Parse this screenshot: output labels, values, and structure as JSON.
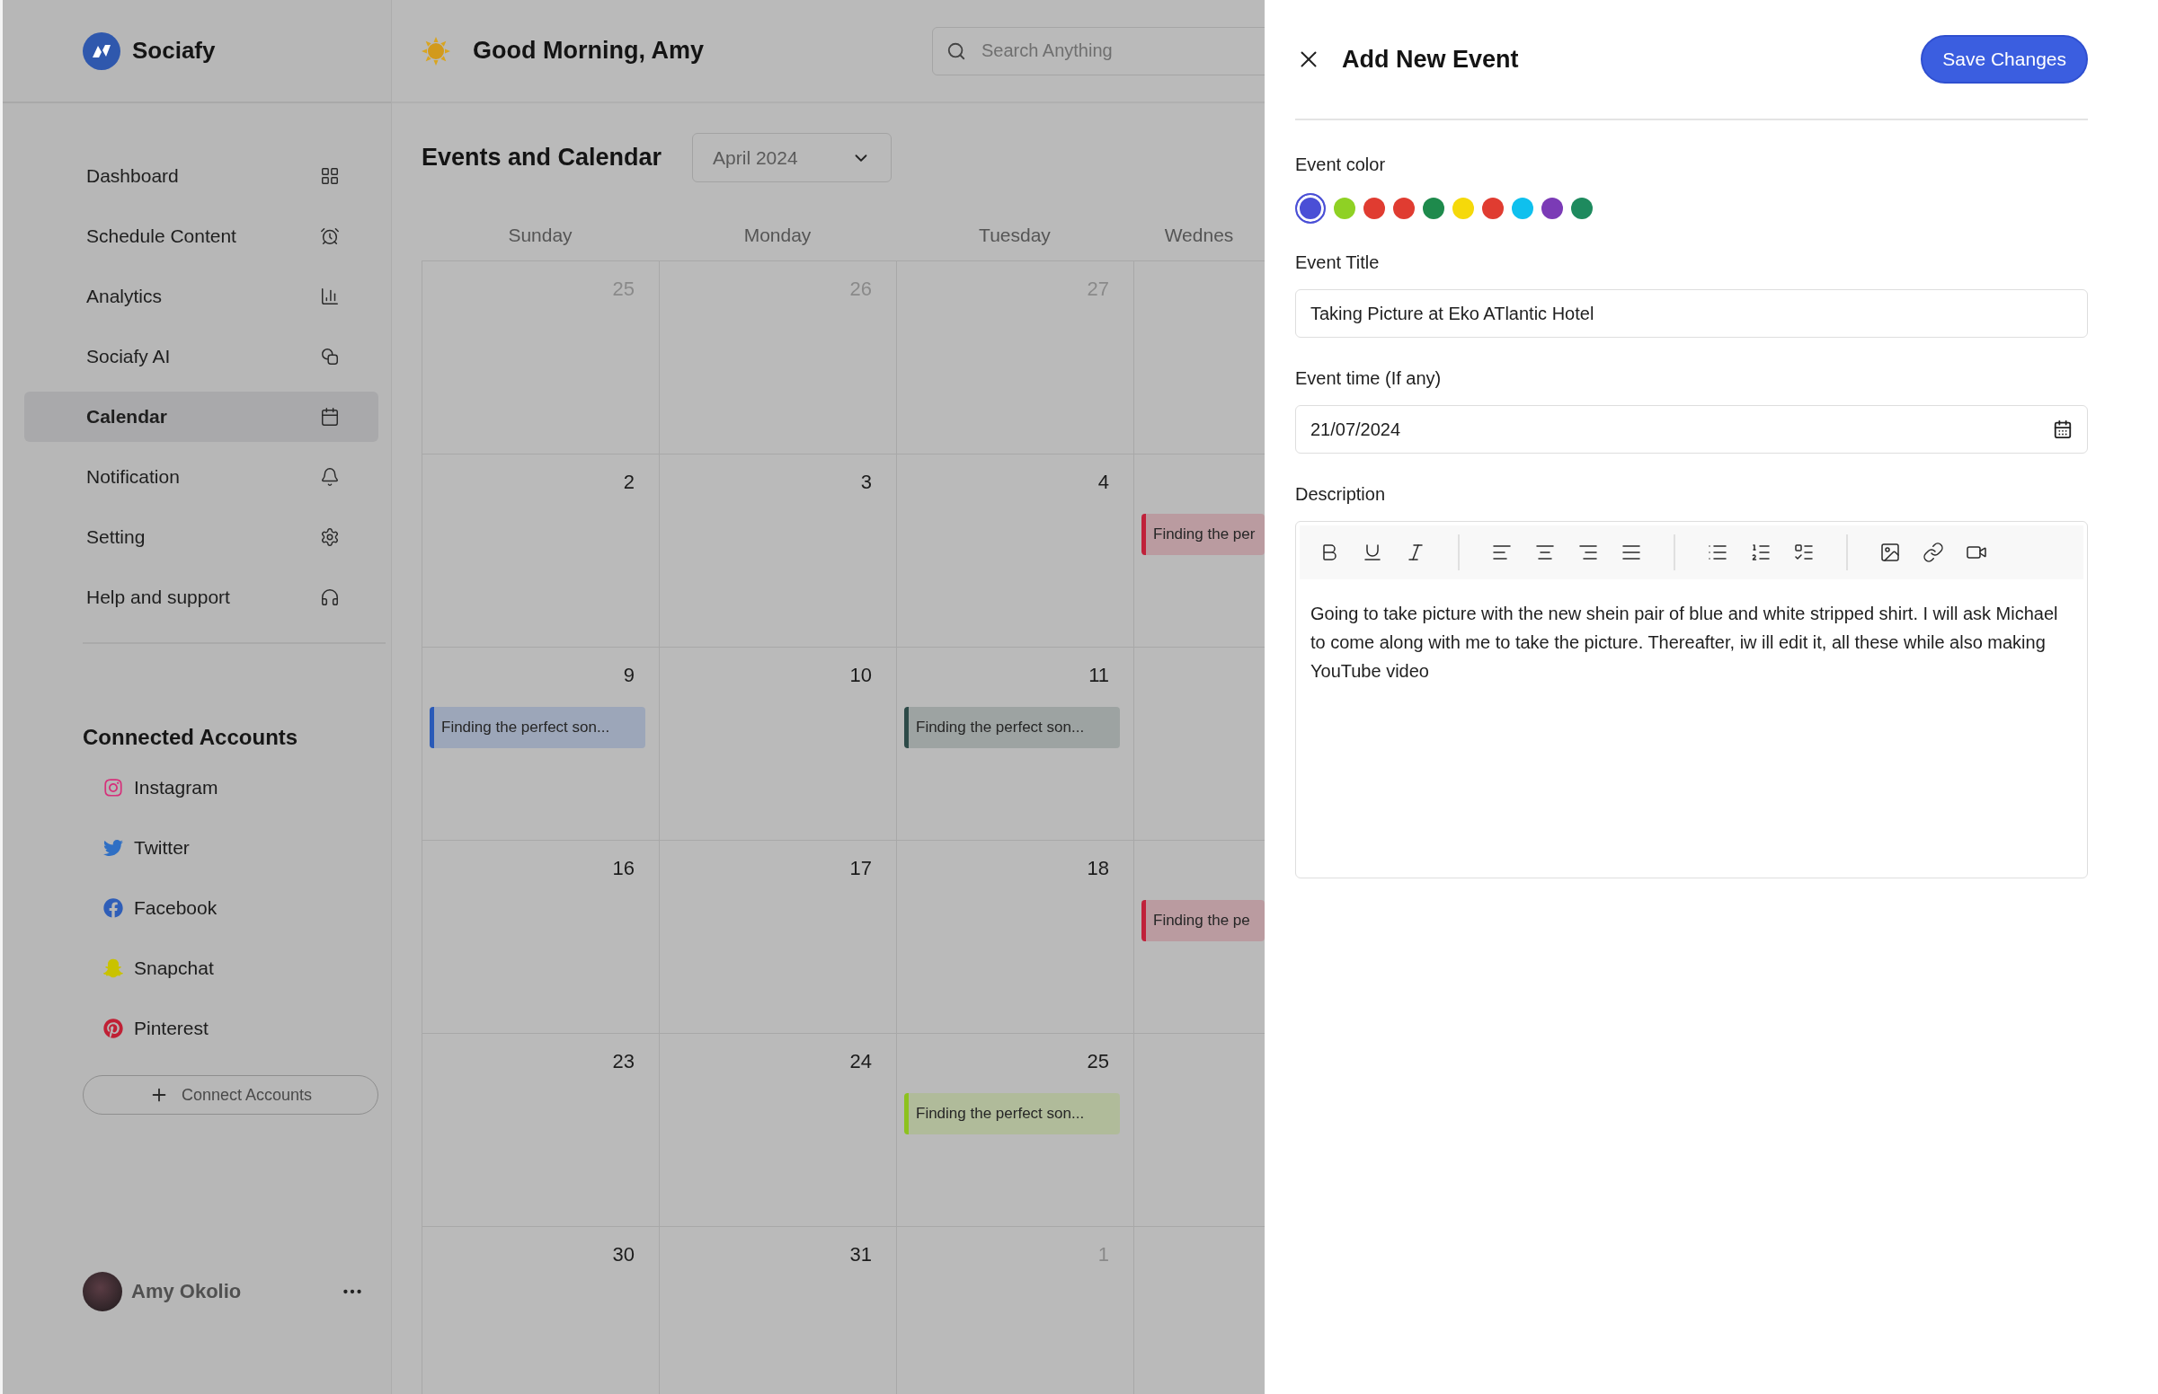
{
  "sidebar": {
    "brand": "Sociafy",
    "nav_items": [
      {
        "label": "Dashboard",
        "selected": false
      },
      {
        "label": "Schedule Content",
        "selected": false
      },
      {
        "label": "Analytics",
        "selected": false
      },
      {
        "label": "Sociafy AI",
        "selected": false
      },
      {
        "label": "Calendar",
        "selected": true
      },
      {
        "label": "Notification",
        "selected": false
      },
      {
        "label": "Setting",
        "selected": false
      },
      {
        "label": "Help and support",
        "selected": false
      }
    ],
    "connected_title": "Connected Accounts",
    "accounts": [
      {
        "label": "Instagram",
        "kind": "instagram"
      },
      {
        "label": "Twitter",
        "kind": "twitter"
      },
      {
        "label": "Facebook",
        "kind": "facebook"
      },
      {
        "label": "Snapchat",
        "kind": "snapchat"
      },
      {
        "label": "Pinterest",
        "kind": "pinterest"
      }
    ],
    "connect_button": "Connect Accounts",
    "user": {
      "name": "Amy Okolio"
    }
  },
  "header": {
    "greeting": "Good Morning, Amy",
    "search": {
      "placeholder": "Search Anything"
    }
  },
  "calendar": {
    "title": "Events and Calendar",
    "month": "April 2024",
    "weekdays": [
      "Sunday",
      "Monday",
      "Tuesday",
      "Wednes"
    ],
    "weeks": [
      {
        "days": [
          {
            "date": "25",
            "muted": true
          },
          {
            "date": "26",
            "muted": true
          },
          {
            "date": "27",
            "muted": true
          }
        ]
      },
      {
        "days": [
          {
            "date": "2",
            "muted": false
          },
          {
            "date": "3",
            "muted": false
          },
          {
            "date": "4",
            "muted": false
          },
          {
            "events": [
              {
                "title": "Finding the per",
                "color": "#c0213a"
              }
            ]
          }
        ]
      },
      {
        "days": [
          {
            "date": "9",
            "muted": false,
            "events": [
              {
                "title": "Finding the perfect son...",
                "color": "#2a5ab8"
              }
            ]
          },
          {
            "date": "10",
            "muted": false
          },
          {
            "date": "11",
            "muted": false,
            "events": [
              {
                "title": "Finding the perfect son...",
                "color": "#2d4a48"
              }
            ]
          }
        ]
      },
      {
        "days": [
          {
            "date": "16",
            "muted": false
          },
          {
            "date": "17",
            "muted": false
          },
          {
            "date": "18",
            "muted": false
          },
          {
            "events": [
              {
                "title": "Finding the pe",
                "color": "#c0213a"
              }
            ]
          }
        ]
      },
      {
        "days": [
          {
            "date": "23",
            "muted": false
          },
          {
            "date": "24",
            "muted": false
          },
          {
            "date": "25",
            "muted": false,
            "events": [
              {
                "title": "Finding the perfect son...",
                "color": "#8dc21f"
              }
            ]
          }
        ]
      },
      {
        "days": [
          {
            "date": "30",
            "muted": false
          },
          {
            "date": "31",
            "muted": false
          },
          {
            "date": "1",
            "muted": true
          }
        ]
      }
    ]
  },
  "panel": {
    "title": "Add New Event",
    "save_button": "Save Changes",
    "color_label": "Event color",
    "event_colors": [
      {
        "color": "#4a4fd6",
        "selected": true
      },
      {
        "color": "#8fd124",
        "selected": false
      },
      {
        "color": "#e03c31",
        "selected": false
      },
      {
        "color": "#e03c31",
        "selected": false
      },
      {
        "color": "#1e8a4c",
        "selected": false
      },
      {
        "color": "#f5d90a",
        "selected": false
      },
      {
        "color": "#e03c31",
        "selected": false
      },
      {
        "color": "#0fc0ee",
        "selected": false
      },
      {
        "color": "#7b3bb6",
        "selected": false
      },
      {
        "color": "#1e8a5e",
        "selected": false
      }
    ],
    "title_label": "Event Title",
    "title_value": "Taking Picture at Eko ATlantic Hotel",
    "time_label": "Event time (If any)",
    "time_value": "21/07/2024",
    "description_label": "Description",
    "description": "Going to take picture with the new shein pair of blue and white stripped shirt. I will ask Michael to come along with me to take the picture. Thereafter, iw ill edit it, all these while also making YouTube video"
  }
}
